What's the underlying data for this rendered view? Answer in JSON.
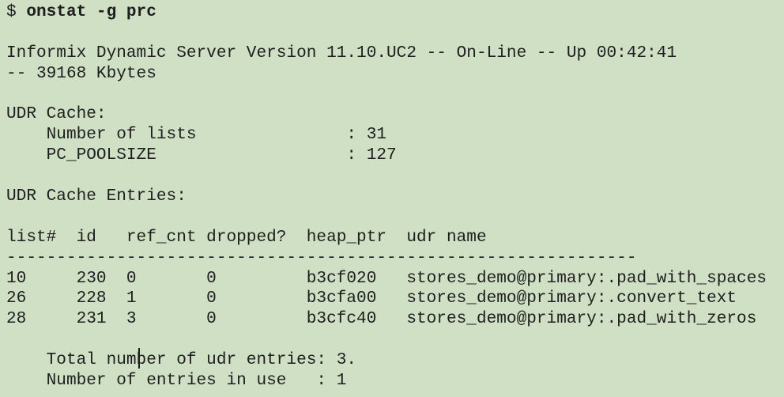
{
  "prompt": "$ ",
  "command": "onstat -g prc",
  "header": {
    "line1": "Informix Dynamic Server Version 11.10.UC2 -- On-Line -- Up 00:42:41",
    "line2": "-- 39168 Kbytes"
  },
  "udr_cache": {
    "title": "UDR Cache:",
    "lines": [
      "    Number of lists               : 31",
      "    PC_POOLSIZE                   : 127"
    ]
  },
  "entries": {
    "title": "UDR Cache Entries:",
    "header": "list#  id   ref_cnt dropped?  heap_ptr  udr name",
    "separator": "---------------------------------------------------------------",
    "rows": [
      "10     230  0       0         b3cf020   stores_demo@primary:.pad_with_spaces",
      "26     228  1       0         b3cfa00   stores_demo@primary:.convert_text",
      "28     231  3       0         b3cfc40   stores_demo@primary:.pad_with_zeros"
    ]
  },
  "summary": {
    "total": "    Total number of udr entries: 3.",
    "in_use": "    Number of entries in use   : 1"
  }
}
